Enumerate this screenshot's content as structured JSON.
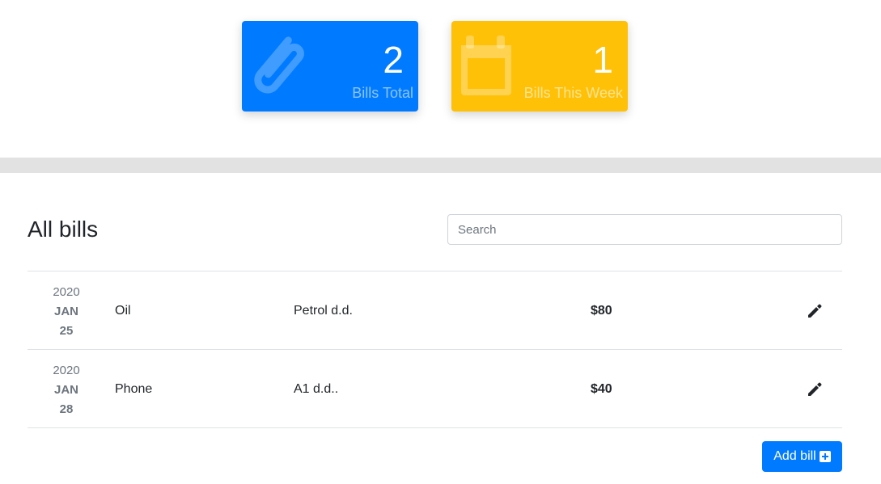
{
  "colors": {
    "blue_card": "#007bff",
    "yellow_card": "#ffc107",
    "primary_button": "#007bff"
  },
  "stats": [
    {
      "value": "2",
      "label": "Bills Total",
      "icon": "paperclip-icon"
    },
    {
      "value": "1",
      "label": "Bills This Week",
      "icon": "calendar-icon"
    }
  ],
  "bills_section": {
    "title": "All bills",
    "search_placeholder": "Search"
  },
  "bills": [
    {
      "year": "2020",
      "month": "JAN",
      "day": "25",
      "category": "Oil",
      "company": "Petrol d.d.",
      "amount": "$80",
      "edit_icon": "pencil-icon"
    },
    {
      "year": "2020",
      "month": "JAN",
      "day": "28",
      "category": "Phone",
      "company": "A1 d.d..",
      "amount": "$40",
      "edit_icon": "pencil-icon"
    }
  ],
  "add_bill": {
    "label": "Add bill",
    "icon": "plus-square-icon"
  }
}
